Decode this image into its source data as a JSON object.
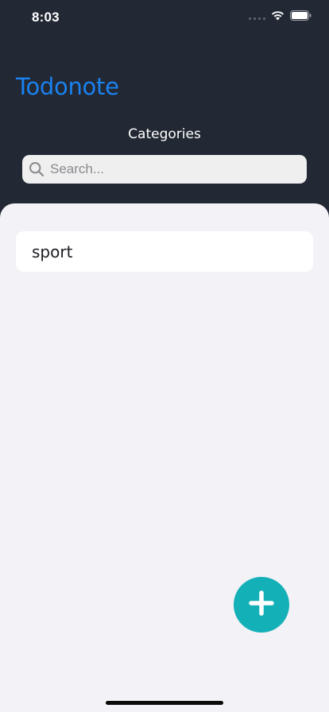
{
  "status_bar": {
    "time": "8:03",
    "icons": [
      "signal-icon",
      "wifi-icon",
      "battery-icon"
    ]
  },
  "header": {
    "app_title": "Todonote",
    "section_label": "Categories",
    "title_color": "#1a82ef",
    "background_color": "#222834"
  },
  "search": {
    "placeholder": "Search...",
    "value": ""
  },
  "categories": [
    {
      "label": "sport"
    }
  ],
  "fab": {
    "icon": "plus-icon",
    "color": "#14b0b7"
  }
}
